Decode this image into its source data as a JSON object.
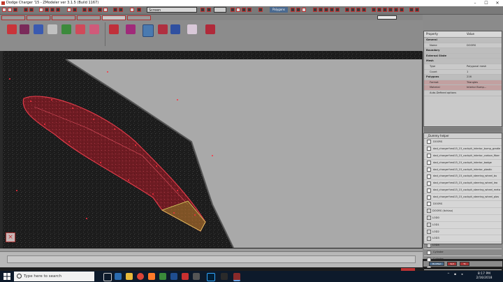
{
  "window": {
    "title": "Dodge Charger '15 - ZModeler ver 3.1.5 (Build 1167)",
    "minimize": "–",
    "maximize": "☐",
    "close": "✕"
  },
  "toolbar": {
    "view_select": "Screen",
    "mode_pill": "Polygons"
  },
  "properties": {
    "header_property": "Property",
    "header_value": "Value",
    "rows": [
      {
        "key": "General",
        "value": "",
        "section": true
      },
      {
        "key": "Name",
        "value": "DOORS"
      },
      {
        "key": "Boundary",
        "value": "",
        "section": true
      },
      {
        "key": "External State",
        "value": "",
        "section": true
      },
      {
        "key": "Mesh",
        "value": "",
        "section": true
      },
      {
        "key": "Type",
        "value": "Polygonal mesh"
      },
      {
        "key": "Count",
        "value": "1"
      },
      {
        "key": "Polygons",
        "value": "216",
        "section": true
      },
      {
        "key": "Format",
        "value": "Triangles",
        "sel": true
      },
      {
        "key": "Material",
        "value": "Interior Bump...",
        "sel": true
      },
      {
        "key": "Auto-Defined options",
        "value": ""
      }
    ]
  },
  "hierarchy": {
    "header": "_Dummy helper",
    "items": [
      {
        "label": "DOORS",
        "type": "chk"
      },
      {
        "label": "dad_charger'test15_15_cockpit_interior_bump_gradie",
        "type": "chk"
      },
      {
        "label": "dad_charger'test15_15_cockpit_interior_carbon_fiber",
        "type": "chk"
      },
      {
        "label": "dad_charger'test15_15_cockpit_interior_badge",
        "type": "chk"
      },
      {
        "label": "dad_charger'test15_15_cockpit_interior_plastic",
        "type": "chk"
      },
      {
        "label": "dad_charger'test15_15_cockpit_steering_wheel_bu",
        "type": "chk"
      },
      {
        "label": "dad_charger'test15_15_cockpit_steering_wheel_lea",
        "type": "chk"
      },
      {
        "label": "dad_charger'test15_15_cockpit_steering_wheel_meta",
        "type": "chk"
      },
      {
        "label": "dad_charger'test15_15_cockpit_steering_wheel_plas",
        "type": "chk"
      },
      {
        "label": "DOORS",
        "type": "chk"
      },
      {
        "label": "DOORS (itchiao)",
        "type": "plus"
      },
      {
        "label": "LOD0",
        "type": "plus"
      },
      {
        "label": "LOD1",
        "type": "plus"
      },
      {
        "label": "LOD2",
        "type": "plus"
      },
      {
        "label": "LOD3",
        "type": "plus"
      },
      {
        "label": "LOD4",
        "type": "plus"
      },
      {
        "label": "Cylinder",
        "type": "chk"
      },
      {
        "label": "Cylinder",
        "type": "chk"
      },
      {
        "label": "DOORS",
        "type": "chk"
      }
    ]
  },
  "bottom_buttons": {
    "b1": "Modified",
    "b2": "Vert",
    "b3": "Tri"
  },
  "taskbar": {
    "search_placeholder": "Type here to search",
    "time": "8:17 PM",
    "date": "2/16/2018"
  },
  "colors": {
    "accent_red": "#c03030",
    "viewport_gray": "#a9a9a9",
    "selection_red": "#b4202a",
    "taskbar": "#0d1a2b"
  }
}
